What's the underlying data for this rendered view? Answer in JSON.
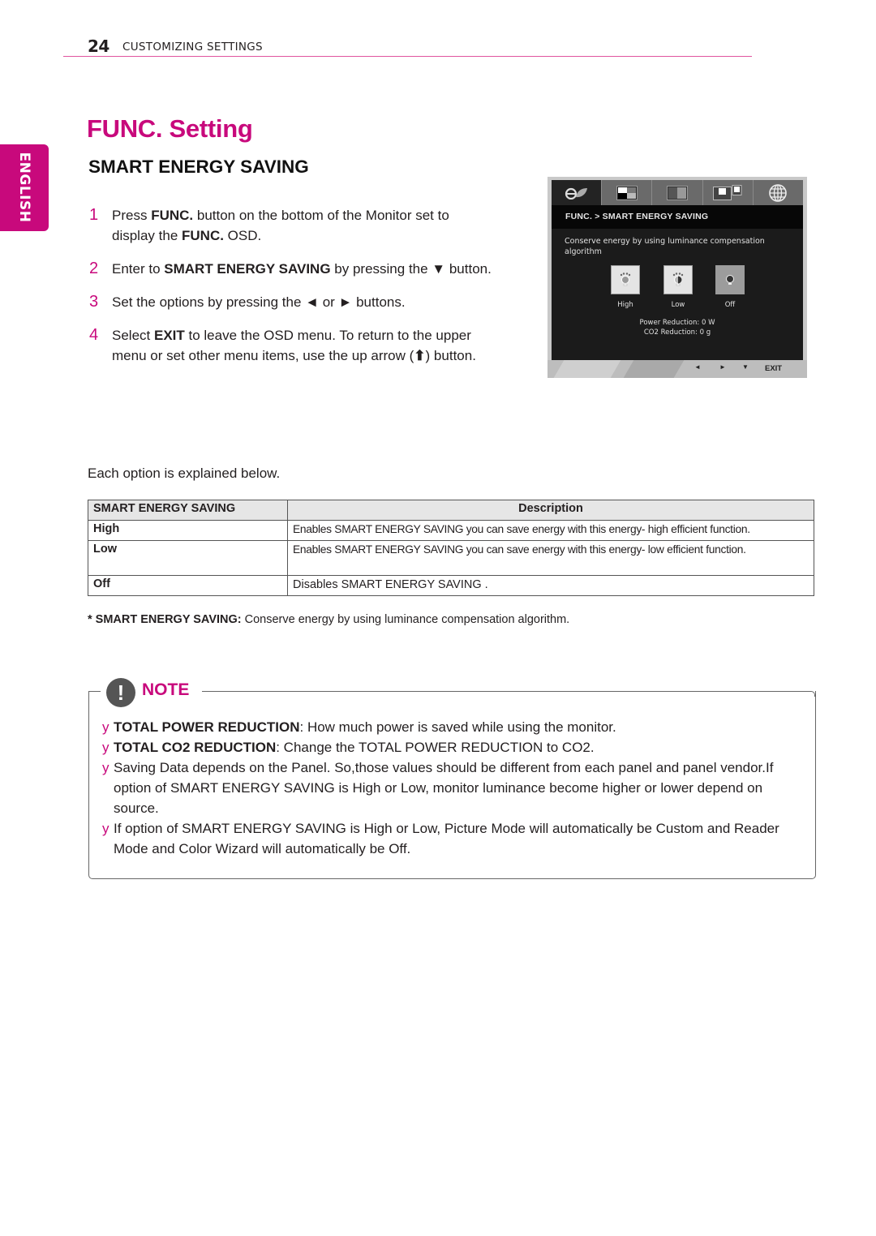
{
  "header": {
    "page_number": "24",
    "section": "CUSTOMIZING SETTINGS"
  },
  "language_tab": "ENGLISH",
  "title": "FUNC. Setting",
  "subtitle": "SMART ENERGY SAVING",
  "steps": [
    {
      "num": "1",
      "parts": [
        "Press ",
        "FUNC.",
        " button on the bottom of the Monitor set to display the ",
        "FUNC.",
        " OSD."
      ]
    },
    {
      "num": "2",
      "parts": [
        "Enter to ",
        "SMART ENERGY SAVING",
        "  by pressing the ▼ button."
      ]
    },
    {
      "num": "3",
      "text": "Set the options by pressing the ◄ or ► buttons."
    },
    {
      "num": "4",
      "parts": [
        "Select ",
        "EXIT",
        " to leave the OSD menu. To return to the upper menu or set other menu items, use the up arrow (",
        "⬆",
        ") button."
      ]
    }
  ],
  "osd": {
    "tabs": [
      "eco-leaf-icon",
      "picture-icon",
      "color-icon",
      "pip-icon",
      "language-globe-icon"
    ],
    "breadcrumb": "FUNC.  >  SMART ENERGY SAVING",
    "description": "Conserve energy by using luminance compensation algorithm",
    "options": [
      {
        "label": "High",
        "selected": false
      },
      {
        "label": "Low",
        "selected": false
      },
      {
        "label": "Off",
        "selected": true
      }
    ],
    "power_reduction": "Power Reduction: 0 W",
    "co2_reduction": "CO2 Reduction: 0 g",
    "footer_buttons": {
      "left": "◄",
      "right": "►",
      "down": "▼",
      "exit": "EXIT"
    }
  },
  "explain_text": "Each option is explained below.",
  "table": {
    "headers": [
      "SMART ENERGY SAVING",
      "Description"
    ],
    "rows": [
      {
        "option": "High",
        "description": "Enables SMART ENERGY SAVING  you can save energy with this energy- high efficient function."
      },
      {
        "option": "Low",
        "description": "Enables SMART ENERGY SAVING  you can save energy with this energy- low efficient function."
      },
      {
        "option": "Off",
        "description": "Disables SMART ENERGY SAVING ."
      }
    ]
  },
  "footnote": {
    "label": "* SMART ENERGY SAVING:",
    "text": " Conserve energy by using luminance compensation algorithm."
  },
  "note": {
    "label": "NOTE",
    "bullet": "y",
    "items": [
      {
        "bold": "TOTAL POWER REDUCTION",
        "text": ": How much power is saved while using the monitor."
      },
      {
        "bold": "TOTAL CO2 REDUCTION",
        "text": ": Change the TOTAL POWER REDUCTION to CO2."
      },
      {
        "bold": "",
        "text": "Saving Data depends on the Panel. So,those values should be different from each panel and panel vendor.If option of SMART ENERGY SAVING is High or Low, monitor luminance become higher or lower depend on source."
      },
      {
        "bold": "",
        "text": " If option of SMART ENERGY SAVING is High or Low, Picture Mode will automatically be Custom and Reader Mode and Color Wizard will automatically be Off."
      }
    ]
  },
  "colors": {
    "accent": "#c8097c",
    "osd_bg": "#1b1b1b"
  }
}
